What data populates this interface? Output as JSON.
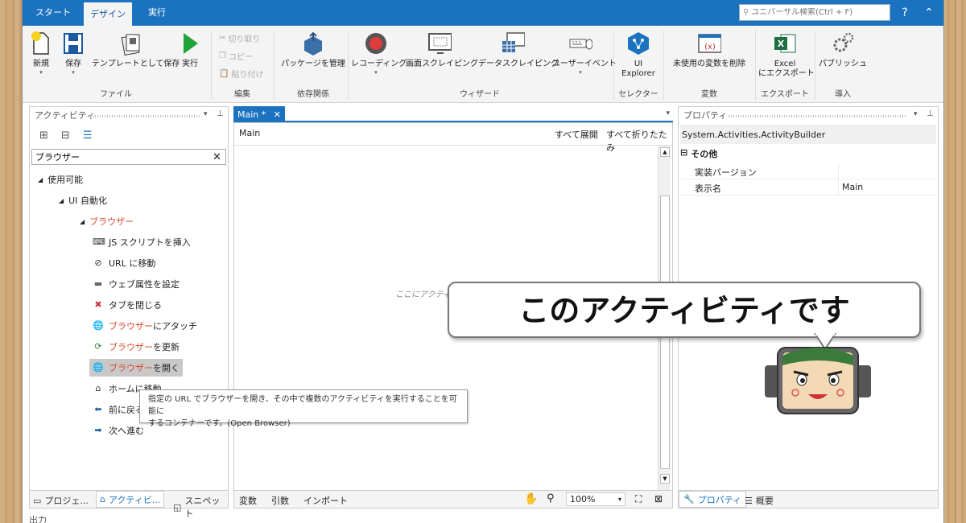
{
  "tabs": [
    "スタート",
    "デザイン",
    "実行"
  ],
  "search": {
    "placeholder": "ユニバーサル検索(Ctrl + F)"
  },
  "ribbon": {
    "file": {
      "new": "新規",
      "save": "保存",
      "save_template": "テンプレートとして保存",
      "run": "実行",
      "group": "ファイル"
    },
    "edit": {
      "cut": "切り取り",
      "copy": "コピー",
      "paste": "貼り付け",
      "group": "編集"
    },
    "deps": {
      "manage": "パッケージを管理",
      "group": "依存関係"
    },
    "wizard": {
      "recording": "レコーディング",
      "screen_scraping": "画面スクレイピング",
      "data_scraping": "データスクレイピング",
      "user_events": "ユーザーイベント",
      "group": "ウィザード"
    },
    "selector": {
      "ui_explorer_1": "UI",
      "ui_explorer_2": "Explorer",
      "group": "セレクター"
    },
    "variables": {
      "remove_unused": "未使用の変数を削除",
      "group": "変数"
    },
    "export": {
      "excel_1": "Excel",
      "excel_2": "にエクスポート",
      "group": "エクスポート"
    },
    "deploy": {
      "publish": "パブリッシュ",
      "group": "導入"
    }
  },
  "activities": {
    "title": "アクティビティ",
    "filter": "ブラウザー",
    "tree": {
      "available": "使用可能",
      "ui_automation": "UI 自動化",
      "browser": "ブラウザー"
    },
    "items": [
      {
        "pre": "",
        "red": "",
        "post": "JS スクリプトを挿入"
      },
      {
        "pre": "",
        "red": "",
        "post": "URL に移動"
      },
      {
        "pre": "",
        "red": "",
        "post": "ウェブ属性を設定"
      },
      {
        "pre": "",
        "red": "",
        "post": "タブを閉じる"
      },
      {
        "pre": "",
        "red": "ブラウザー",
        "post": "にアタッチ"
      },
      {
        "pre": "",
        "red": "ブラウザー",
        "post": "を更新"
      },
      {
        "pre": "",
        "red": "ブラウザー",
        "post": "を開く"
      },
      {
        "pre": "",
        "red": "",
        "post": "ホームに移動"
      },
      {
        "pre": "",
        "red": "",
        "post": "前に戻る"
      },
      {
        "pre": "",
        "red": "",
        "post": "次へ進む"
      }
    ],
    "bottom_tabs": [
      "プロジェ...",
      "アクティビ...",
      "スニペット"
    ]
  },
  "designer": {
    "tab": "Main *",
    "breadcrumb": "Main",
    "expand_all": "すべて展開",
    "collapse_all": "すべて折りたたみ",
    "drop_hint": "ここにアクティビティをドロップ",
    "bottom": {
      "variables": "変数",
      "arguments": "引数",
      "imports": "インポート",
      "zoom": "100%"
    }
  },
  "properties": {
    "title": "プロパティ",
    "type": "System.Activities.ActivityBuilder",
    "category": "その他",
    "rows": [
      {
        "name": "実装バージョン",
        "value": ""
      },
      {
        "name": "表示名",
        "value": "Main"
      }
    ],
    "bottom_tabs": [
      "プロパティ",
      "概要"
    ]
  },
  "output_label": "出力",
  "tooltip": {
    "line1": "指定の URL でブラウザーを開き、その中で複数のアクティビティを実行することを可能に",
    "line2": "するコンテナーです。(Open Browser)"
  },
  "callout": "このアクティビティです",
  "colors": {
    "accent": "#1b72be",
    "highlight": "#d94a2d"
  }
}
